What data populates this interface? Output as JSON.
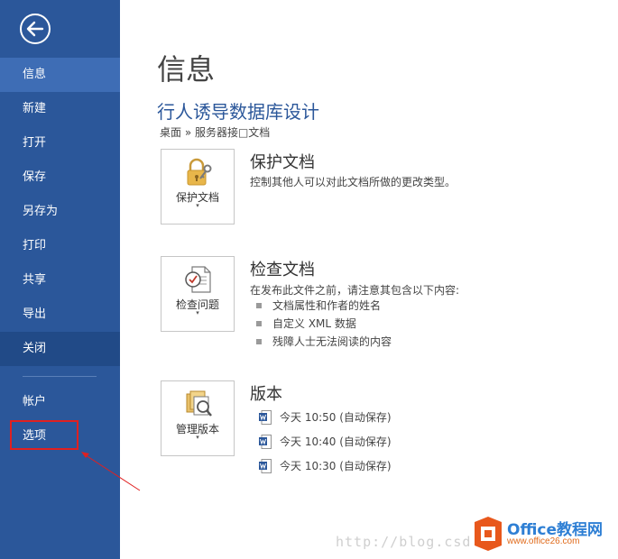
{
  "sidebar": {
    "items": [
      {
        "label": "信息"
      },
      {
        "label": "新建"
      },
      {
        "label": "打开"
      },
      {
        "label": "保存"
      },
      {
        "label": "另存为"
      },
      {
        "label": "打印"
      },
      {
        "label": "共享"
      },
      {
        "label": "导出"
      },
      {
        "label": "关闭"
      }
    ],
    "account_label": "帐户",
    "options_label": "选项",
    "back_icon": "back-arrow-icon"
  },
  "main": {
    "page_title": "信息",
    "doc_title": "行人诱导数据库设计",
    "breadcrumb": "桌面 » 服务器接□文档",
    "protect": {
      "tile_label": "保护文档",
      "caret": "▾",
      "title": "保护文档",
      "desc": "控制其他人可以对此文档所做的更改类型。",
      "icon": "lock-key-icon"
    },
    "inspect": {
      "tile_label": "检查问题",
      "caret": "▾",
      "title": "检查文档",
      "desc": "在发布此文件之前，请注意其包含以下内容:",
      "bullets": [
        "文档属性和作者的姓名",
        "自定义 XML 数据",
        "残障人士无法阅读的内容"
      ],
      "icon": "inspect-document-icon"
    },
    "versions": {
      "tile_label": "管理版本",
      "caret": "▾",
      "title": "版本",
      "entries": [
        "今天 10:50 (自动保存)",
        "今天 10:40 (自动保存)",
        "今天 10:30 (自动保存)"
      ],
      "icon": "manage-versions-icon"
    }
  },
  "watermark": {
    "blog_text": "http://blog.csd",
    "brand": "Office教程网",
    "url": "www.office26.com"
  },
  "colors": {
    "sidebar": "#2b579a",
    "sidebar_active": "#3e6db5",
    "accent": "#2b579a",
    "highlight": "#e02020"
  }
}
